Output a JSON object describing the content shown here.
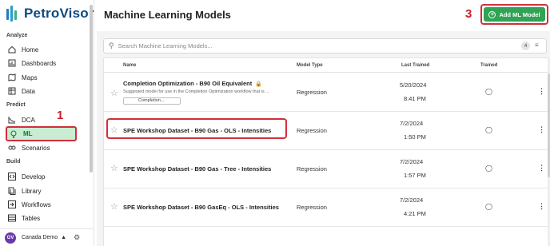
{
  "app": {
    "name": "PetroVisor"
  },
  "sidebar": {
    "sections": [
      {
        "label": "Analyze",
        "items": [
          {
            "label": "Home",
            "icon": "home-icon"
          },
          {
            "label": "Dashboards",
            "icon": "dashboard-icon"
          },
          {
            "label": "Maps",
            "icon": "map-icon"
          },
          {
            "label": "Data",
            "icon": "data-icon"
          }
        ]
      },
      {
        "label": "Predict",
        "items": [
          {
            "label": "DCA",
            "icon": "chart-line-icon"
          },
          {
            "label": "ML",
            "icon": "lightbulb-icon",
            "active": true
          },
          {
            "label": "Scenarios",
            "icon": "scenarios-icon"
          }
        ]
      },
      {
        "label": "Build",
        "items": [
          {
            "label": "Develop",
            "icon": "code-icon"
          },
          {
            "label": "Library",
            "icon": "library-icon"
          },
          {
            "label": "Workflows",
            "icon": "workflow-icon"
          },
          {
            "label": "Tables",
            "icon": "table-icon"
          }
        ]
      }
    ],
    "user": {
      "initials": "GV",
      "workspace": "Canada Demo"
    }
  },
  "annotations": [
    "1",
    "2",
    "3"
  ],
  "header": {
    "title": "Machine Learning Models",
    "add_button": "Add ML Model"
  },
  "search": {
    "placeholder": "Search Machine Learning Models...",
    "count": "4"
  },
  "table": {
    "columns": [
      "Name",
      "Model Type",
      "Last Trained",
      "Trained"
    ],
    "rows": [
      {
        "name": "Completion Optimization - B90 Oil Equivalent",
        "locked": true,
        "description": "Suggested model for use in the Completion Optimization workflow that is ...",
        "tag": "Completion...",
        "model_type": "Regression",
        "date": "5/20/2024",
        "time": "8:41 PM"
      },
      {
        "name": "SPE Workshop Dataset - B90 Gas - OLS - Intensities",
        "model_type": "Regression",
        "date": "7/2/2024",
        "time": "1:50 PM"
      },
      {
        "name": "SPE Workshop Dataset - B90 Gas - Tree - Intensities",
        "model_type": "Regression",
        "date": "7/2/2024",
        "time": "1:57 PM"
      },
      {
        "name": "SPE Workshop Dataset - B90 GasEq - OLS - Intensities",
        "model_type": "Regression",
        "date": "7/2/2024",
        "time": "4:21 PM"
      }
    ]
  },
  "colors": {
    "accent_green": "#31a354",
    "brand_blue": "#0d4a80",
    "annotation_red": "#d0303a",
    "active_bg": "#c9ecd2"
  }
}
